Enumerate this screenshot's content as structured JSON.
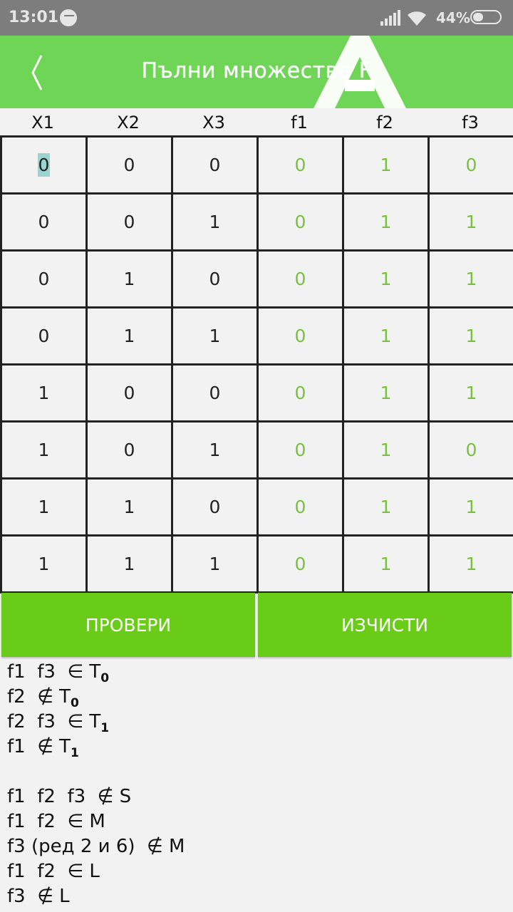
{
  "status_bar": {
    "time": "13:01",
    "battery_percent": "44%"
  },
  "app_bar": {
    "title": "Пълни множества F"
  },
  "table": {
    "headers": [
      "X1",
      "X2",
      "X3",
      "f1",
      "f2",
      "f3"
    ],
    "rows": [
      [
        "0",
        "0",
        "0",
        "0",
        "1",
        "0"
      ],
      [
        "0",
        "0",
        "1",
        "0",
        "1",
        "1"
      ],
      [
        "0",
        "1",
        "0",
        "0",
        "1",
        "1"
      ],
      [
        "0",
        "1",
        "1",
        "0",
        "1",
        "1"
      ],
      [
        "1",
        "0",
        "0",
        "0",
        "1",
        "1"
      ],
      [
        "1",
        "0",
        "1",
        "0",
        "1",
        "0"
      ],
      [
        "1",
        "1",
        "0",
        "0",
        "1",
        "1"
      ],
      [
        "1",
        "1",
        "1",
        "0",
        "1",
        "1"
      ]
    ]
  },
  "buttons": {
    "check": "ПРОВЕРИ",
    "clear": "ИЗЧИСТИ"
  },
  "results": [
    {
      "text": "f1  f3  ∈ T",
      "sub": "0"
    },
    {
      "text": "f2  ∉ T",
      "sub": "0"
    },
    {
      "text": "f2  f3  ∈ T",
      "sub": "1"
    },
    {
      "text": "f1  ∉ T",
      "sub": "1"
    },
    {
      "text": "",
      "sub": ""
    },
    {
      "text": "f1  f2  f3  ∉ S",
      "sub": ""
    },
    {
      "text": "f1  f2  ∈ M",
      "sub": ""
    },
    {
      "text": "f3 (ред 2 и 6)  ∉ M",
      "sub": ""
    },
    {
      "text": "f1  f2  ∈ L",
      "sub": ""
    },
    {
      "text": "f3  ∉ L",
      "sub": ""
    }
  ],
  "colors": {
    "app_bar": "#6fd556",
    "button": "#68cc19",
    "function_value": "#7ac143",
    "selection": "#9ad3d0"
  }
}
